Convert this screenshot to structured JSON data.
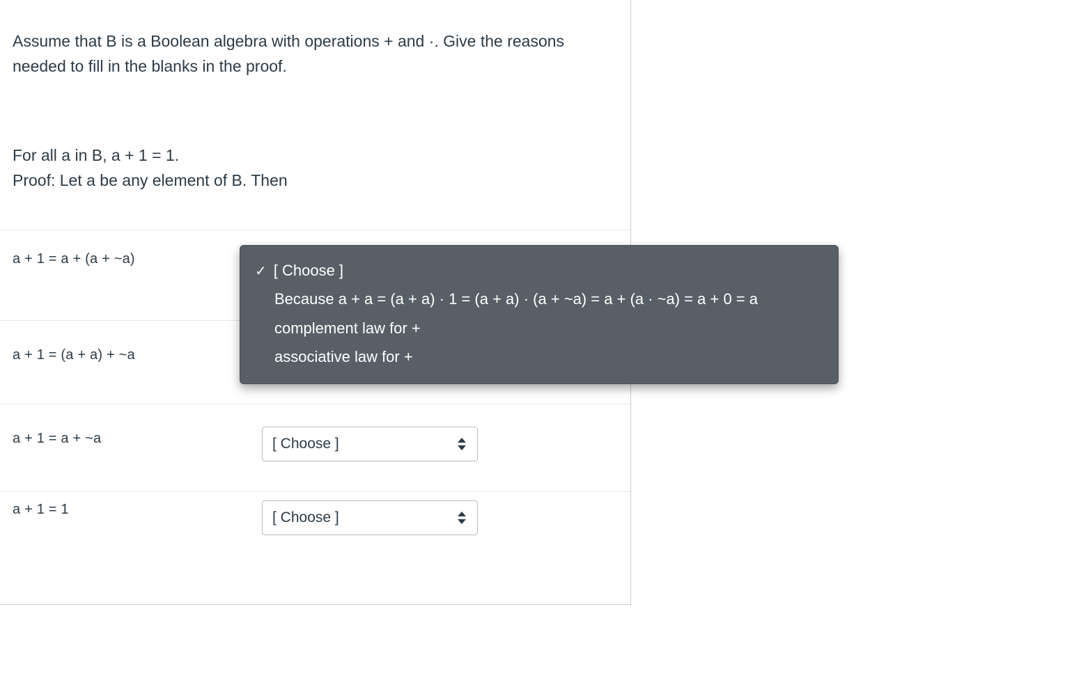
{
  "question": "Assume that B is a Boolean algebra with operations + and ·. Give the reasons needed to fill in the blanks in the proof.",
  "theorem_line1": "For all a in B, a + 1 = 1.",
  "theorem_line2": "Proof: Let a be any element of B. Then",
  "steps": {
    "s1": "a + 1 = a + (a + ~a)",
    "s2": "a + 1 = (a + a) + ~a",
    "s3": "a + 1 = a + ~a",
    "s4": "a + 1 = 1"
  },
  "choose_placeholder": "[ Choose ]",
  "dropdown": {
    "options": {
      "opt0": "[ Choose ]",
      "opt1": "Because a + a = (a + a) · 1 = (a + a) · (a + ~a) = a + (a · ~a) = a + 0 = a",
      "opt2": "complement law for +",
      "opt3": "associative law for +"
    },
    "checkmark": "✓"
  }
}
